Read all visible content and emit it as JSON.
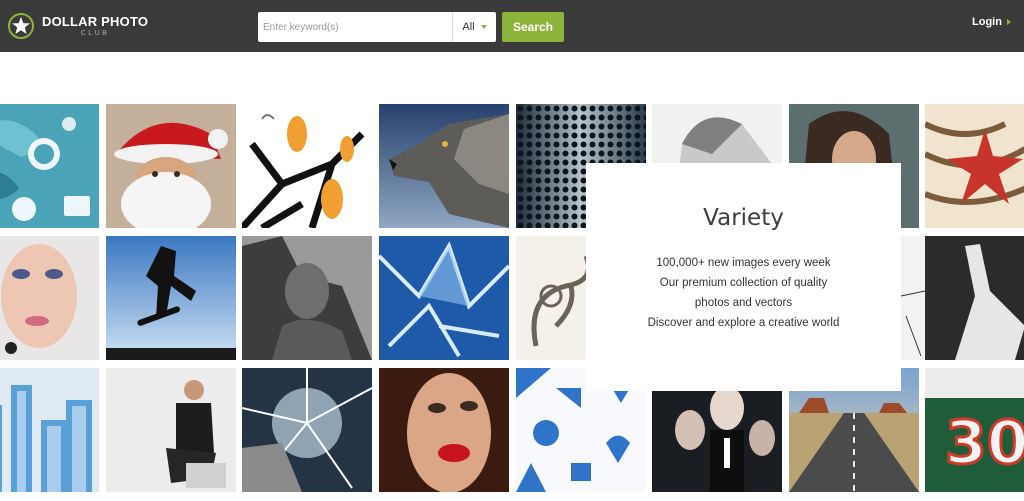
{
  "header": {
    "logo_main": "DOLLAR PHOTO",
    "logo_sub": "CLUB",
    "search_placeholder": "Enter keyword(s)",
    "filter_value": "All",
    "search_button": "Search",
    "login_label": "Login"
  },
  "card": {
    "title": "Variety",
    "lines": [
      "100,000+ new images every week",
      "Our premium collection of quality",
      "photos and vectors",
      "Discover and explore a creative world"
    ]
  },
  "colors": {
    "header_bg": "#3a3a3a",
    "accent": "#8cb43a"
  },
  "icons": [
    "star-logo-icon",
    "chevron-down-icon",
    "chevron-right-icon"
  ]
}
